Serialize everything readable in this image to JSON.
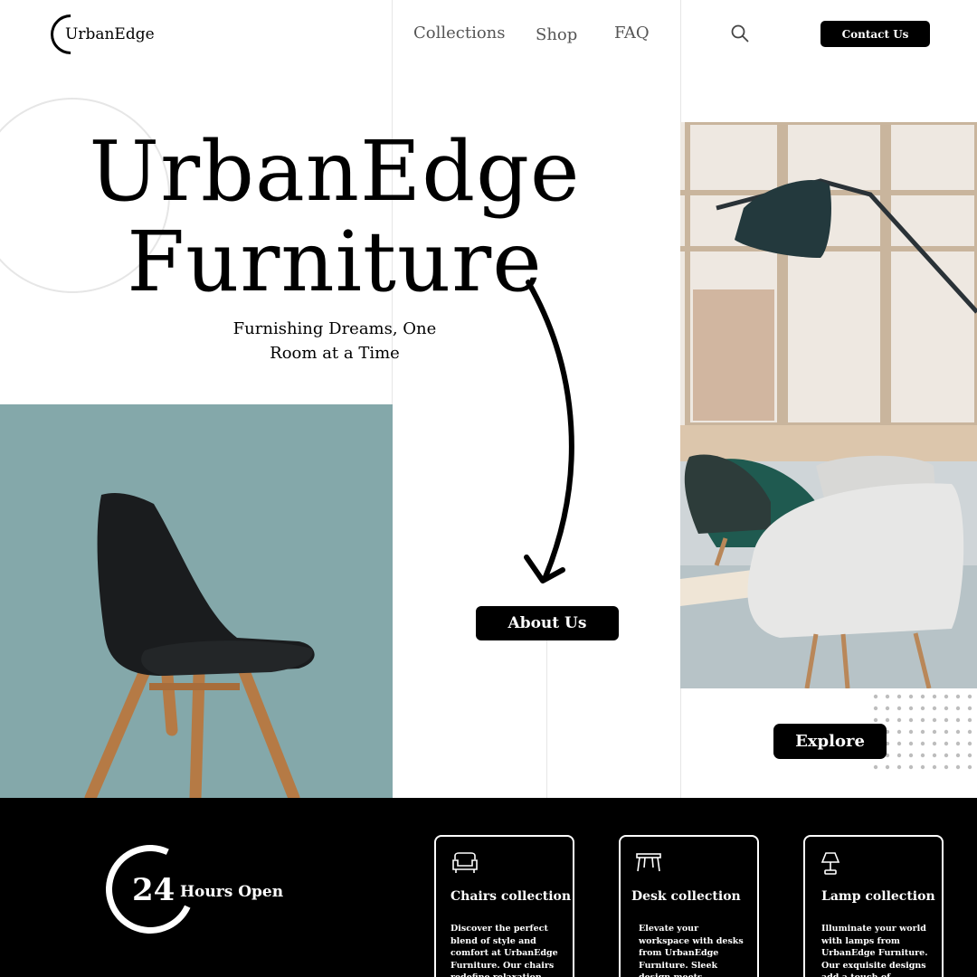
{
  "header": {
    "logo_text": "UrbanEdge",
    "nav": [
      {
        "label": "Collections"
      },
      {
        "label": "Shop"
      },
      {
        "label": "FAQ"
      }
    ],
    "search_icon": "search-icon",
    "contact_label": "Contact Us"
  },
  "hero": {
    "title_line1": "UrbanEdge",
    "title_line2": "Furniture",
    "subtitle_line1": "Furnishing Dreams, One",
    "subtitle_line2": "Room at a Time",
    "about_label": "About Us",
    "explore_label": "Explore"
  },
  "colors": {
    "chair_panel_bg": "#84a8aa",
    "band_bg": "#000000",
    "accent": "#000000"
  },
  "band": {
    "hours_number": "24",
    "hours_label": "Hours Open",
    "cards": [
      {
        "icon": "sofa-icon",
        "title": "Chairs collection",
        "desc": "Discover the perfect blend of style and comfort at UrbanEdge Furniture. Our chairs redefine relaxation, adding"
      },
      {
        "icon": "desk-icon",
        "title": "Desk collection",
        "desc": "Elevate your workspace with desks from UrbanEdge Furniture. Sleek design meets functionality, making"
      },
      {
        "icon": "lamp-icon",
        "title": "Lamp collection",
        "desc": "Illuminate your world with lamps from UrbanEdge Furniture. Our exquisite designs add a touch of elegance and"
      }
    ]
  }
}
